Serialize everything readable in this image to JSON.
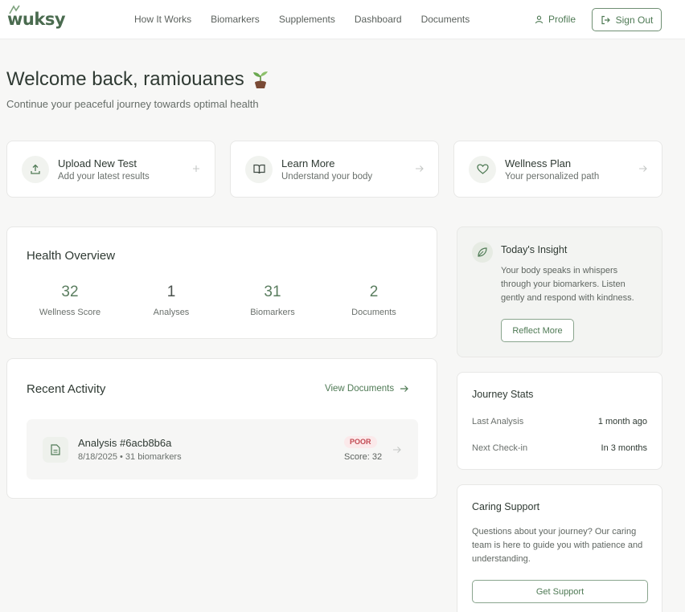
{
  "app": {
    "logo": "wuksy"
  },
  "nav": {
    "items": [
      "How It Works",
      "Biomarkers",
      "Supplements",
      "Dashboard",
      "Documents"
    ]
  },
  "header": {
    "profile_label": "Profile",
    "signout_label": "Sign Out"
  },
  "welcome": {
    "title": "Welcome back, ramiouanes",
    "subtitle": "Continue your peaceful journey towards optimal health"
  },
  "actions": [
    {
      "title": "Upload New Test",
      "subtitle": "Add your latest results",
      "icon": "upload-icon"
    },
    {
      "title": "Learn More",
      "subtitle": "Understand your body",
      "icon": "book-icon"
    },
    {
      "title": "Wellness Plan",
      "subtitle": "Your personalized path",
      "icon": "heart-icon"
    }
  ],
  "overview": {
    "title": "Health Overview",
    "stats": [
      {
        "value": "32",
        "label": "Wellness Score"
      },
      {
        "value": "1",
        "label": "Analyses"
      },
      {
        "value": "31",
        "label": "Biomarkers"
      },
      {
        "value": "2",
        "label": "Documents"
      }
    ]
  },
  "recent": {
    "title": "Recent Activity",
    "view_docs_label": "View Documents",
    "items": [
      {
        "title": "Analysis #6acb8b6a",
        "meta": "8/18/2025 • 31 biomarkers",
        "badge": "POOR",
        "score": "Score: 32"
      }
    ]
  },
  "insight": {
    "title": "Today's Insight",
    "text": "Your body speaks in whispers through your biomarkers. Listen gently and respond with kindness.",
    "button_label": "Reflect More"
  },
  "journey": {
    "title": "Journey Stats",
    "rows": [
      {
        "label": "Last Analysis",
        "value": "1 month ago"
      },
      {
        "label": "Next Check-in",
        "value": "In 3 months"
      }
    ]
  },
  "support": {
    "title": "Caring Support",
    "text": "Questions about your journey? Our caring team is here to guide you with patience and understanding.",
    "button_label": "Get Support"
  },
  "colors": {
    "accent": "#4f7a55",
    "badge_bg": "#fbe9ea",
    "badge_text": "#c24a52",
    "background": "#f7f7f6"
  }
}
